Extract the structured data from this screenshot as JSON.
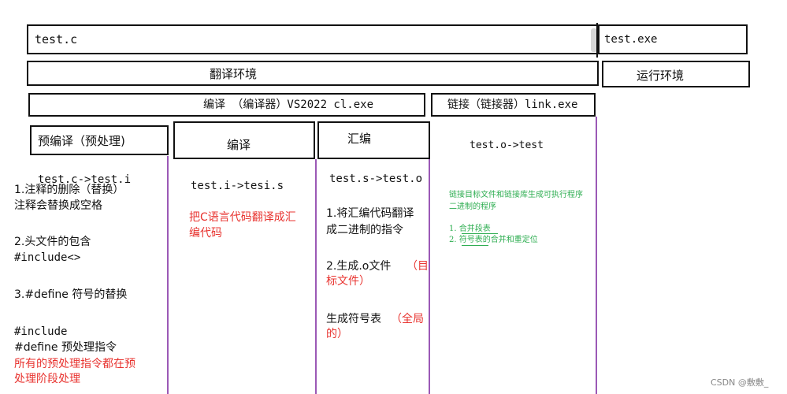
{
  "row1": {
    "left_label": "test.c",
    "right_label": "test.exe"
  },
  "row2": {
    "translate_env": "翻译环境",
    "run_env": "运行环境"
  },
  "row3": {
    "compile_label": "编译 （编译器）VS2022 cl.exe",
    "link_label": "链接（链接器）link.exe"
  },
  "stages": {
    "preprocess": {
      "title": "预编译（预处理)",
      "flow": "test.c->test.i",
      "line1": "1.注释的删除（替换）",
      "line2": "注释会替换成空格",
      "line3": "2.头文件的包含",
      "line4": "#include<>",
      "line5": "3.#define 符号的替换",
      "line6": "#include",
      "line7": "#define 预处理指令",
      "line8": "所有的预处理指令都在预",
      "line9": "处理阶段处理"
    },
    "compile": {
      "title": "编译",
      "flow": "test.i->tesi.s",
      "line1": "把C语言代码翻译成汇",
      "line2": "编代码"
    },
    "assemble": {
      "title": "汇编",
      "flow": "test.s->test.o",
      "line1": "1.将汇编代码翻译",
      "line2": "成二进制的指令",
      "line3a": "2.生成.o文件",
      "line3b": "（目",
      "line4": "标文件）",
      "line5a": "生成符号表",
      "line5b": "（全局",
      "line6": "的）"
    },
    "link": {
      "flow": "test.o->test",
      "desc1": "链接目标文件和链接库生成可执行程序",
      "desc2": "二进制的程序",
      "item1": "1.   合并段表",
      "item2": "2.   符号表的合并和重定位"
    }
  },
  "watermark": "CSDN @敷敷_"
}
